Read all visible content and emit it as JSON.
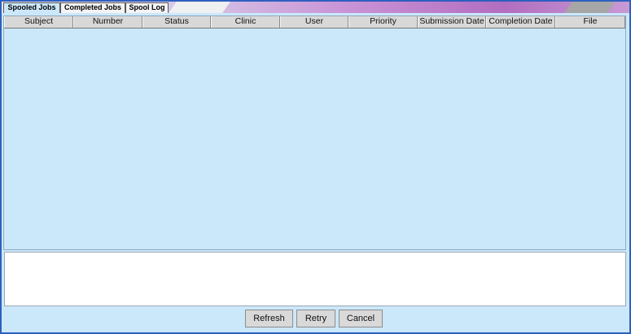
{
  "tabs": [
    {
      "label": "Spooled Jobs",
      "active": true
    },
    {
      "label": "Completed Jobs",
      "active": false
    },
    {
      "label": "Spool Log",
      "active": false
    }
  ],
  "table": {
    "columns": [
      "Subject",
      "Number",
      "Status",
      "Clinic",
      "User",
      "Priority",
      "Submission Date",
      "Completion Date",
      "File"
    ],
    "rows": []
  },
  "message": {
    "text": ""
  },
  "buttons": {
    "refresh": "Refresh",
    "retry": "Retry",
    "cancel": "Cancel"
  },
  "colors": {
    "window_frame": "#2f5fbf",
    "panel_background": "#cbe8fb",
    "header_background": "#d8d8d8"
  }
}
